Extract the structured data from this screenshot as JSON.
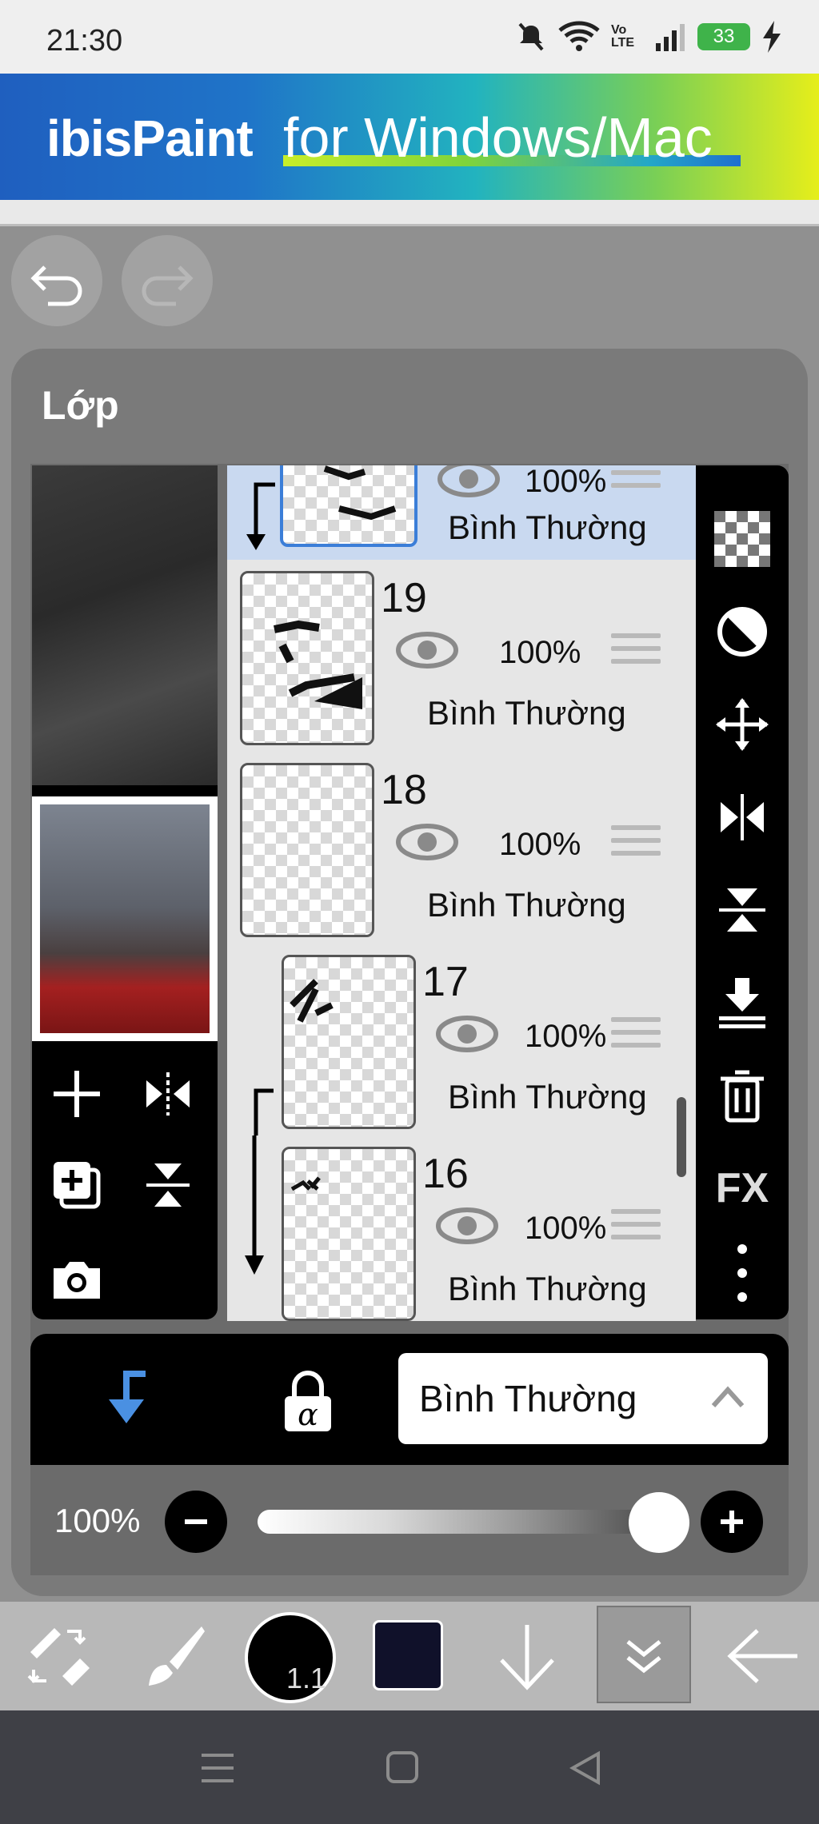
{
  "status_bar": {
    "time": "21:30",
    "battery": "33",
    "network": "Vo LTE"
  },
  "banner": {
    "logo": "ibisPaint",
    "tagline": "for Windows/Mac"
  },
  "panel": {
    "title": "Lớp"
  },
  "layers": [
    {
      "number": "",
      "opacity": "100%",
      "mode": "Bình Thường",
      "selected": true
    },
    {
      "number": "19",
      "opacity": "100%",
      "mode": "Bình Thường"
    },
    {
      "number": "18",
      "opacity": "100%",
      "mode": "Bình Thường"
    },
    {
      "number": "17",
      "opacity": "100%",
      "mode": "Bình Thường"
    },
    {
      "number": "16",
      "opacity": "100%",
      "mode": "Bình Thường"
    }
  ],
  "right_tools": [
    "checker-icon",
    "half-circle-icon",
    "move-icon",
    "flip-horizontal-icon",
    "flip-vertical-icon",
    "merge-down-icon",
    "trash-icon",
    "fx-label",
    "more-icon"
  ],
  "fx_label": "FX",
  "blend_mode": {
    "selected": "Bình Thường"
  },
  "opacity": {
    "label": "100%",
    "value": 1.0
  },
  "brush": {
    "size": "1.1"
  },
  "colors": {
    "accent": "#4a90e2",
    "current_color": "#10112a",
    "banner_start": "#1f5fbf",
    "banner_end": "#e6ee1a"
  }
}
